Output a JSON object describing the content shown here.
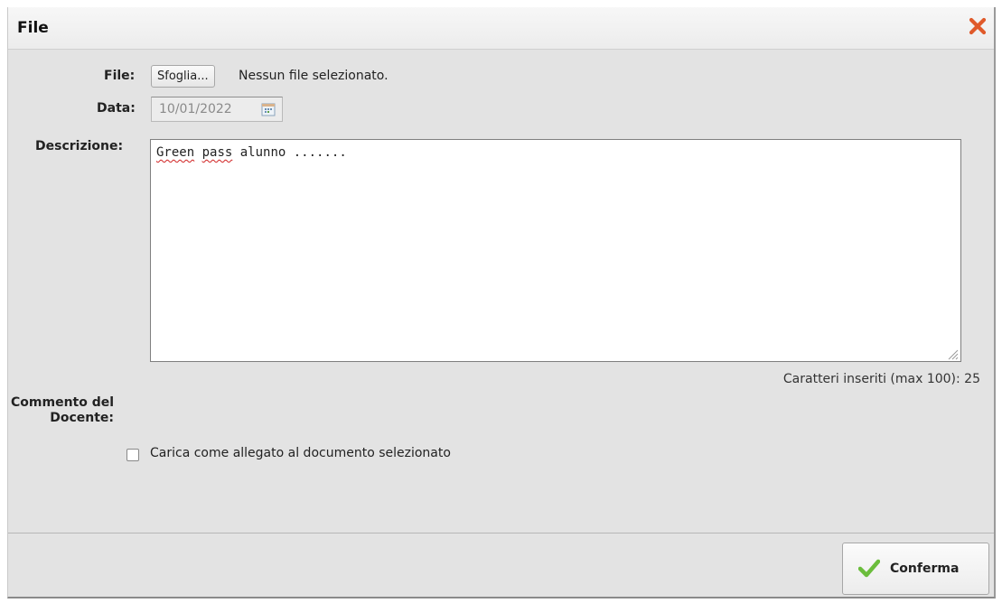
{
  "dialog": {
    "title": "File",
    "close_icon": "close-icon",
    "accent_close": "#e05a2b"
  },
  "form": {
    "file_label": "File:",
    "browse_button": "Sfoglia...",
    "file_status": "Nessun file selezionato.",
    "date_label": "Data:",
    "date_value": "10/01/2022",
    "description_label": "Descrizione:",
    "description_value": "Green pass alunno .......",
    "char_counter": "Caratteri inseriti (max 100): 25",
    "comment_label_line1": "Commento del",
    "comment_label_line2": "Docente:",
    "attach_checkbox_label": "Carica come allegato al documento selezionato",
    "attach_checked": false
  },
  "footer": {
    "confirm_button": "Conferma",
    "confirm_icon": "check-icon",
    "accent_check": "#6bbd3c"
  }
}
